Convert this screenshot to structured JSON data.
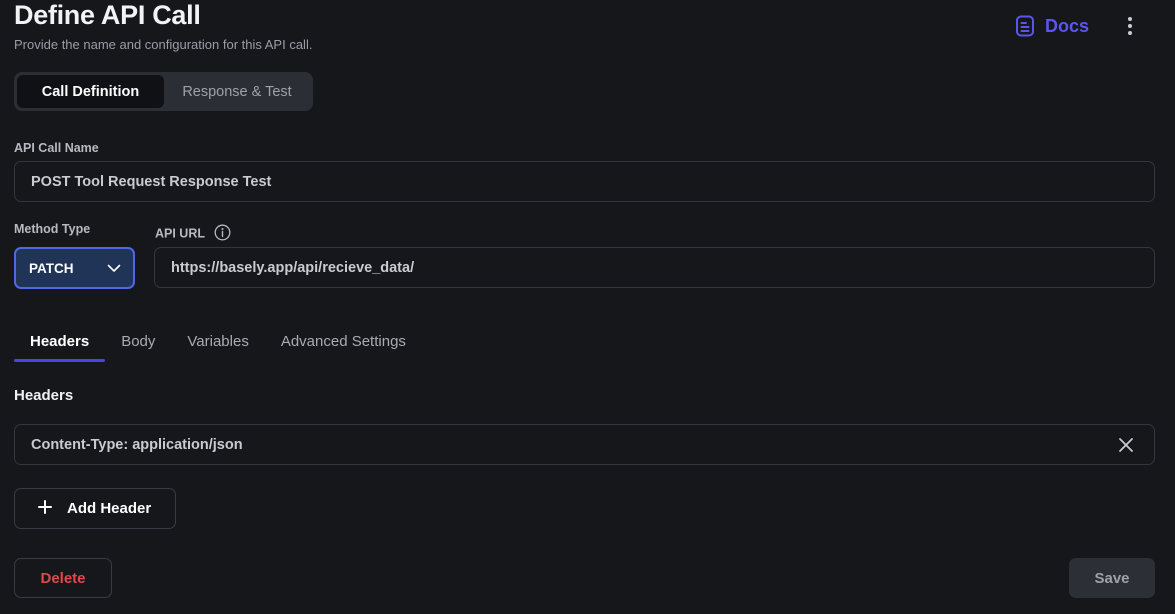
{
  "header": {
    "title": "Define API Call",
    "subtitle": "Provide the name and configuration for this API call.",
    "docs_label": "Docs"
  },
  "segments": [
    {
      "label": "Call Definition",
      "active": true
    },
    {
      "label": "Response & Test",
      "active": false
    }
  ],
  "form": {
    "name_label": "API Call Name",
    "name_value": "POST Tool Request Response Test",
    "method_label": "Method Type",
    "method_value": "PATCH",
    "url_label": "API URL",
    "url_value": "https://basely.app/api/recieve_data/"
  },
  "tabs": [
    {
      "label": "Headers",
      "active": true
    },
    {
      "label": "Body",
      "active": false
    },
    {
      "label": "Variables",
      "active": false
    },
    {
      "label": "Advanced Settings",
      "active": false
    }
  ],
  "headers_section": {
    "title": "Headers",
    "items": [
      "Content-Type: application/json"
    ],
    "add_label": "Add Header"
  },
  "actions": {
    "delete_label": "Delete",
    "save_label": "Save"
  },
  "colors": {
    "background": "#15171b",
    "accent": "#4b43e5",
    "docs": "#5b55f0",
    "method_bg": "#203457",
    "danger": "#e2474a"
  },
  "icons": {
    "docs": "document-icon",
    "menu": "kebab-menu-icon",
    "info": "info-icon",
    "dropdown": "chevron-down-icon",
    "remove": "close-icon",
    "add": "plus-icon"
  }
}
